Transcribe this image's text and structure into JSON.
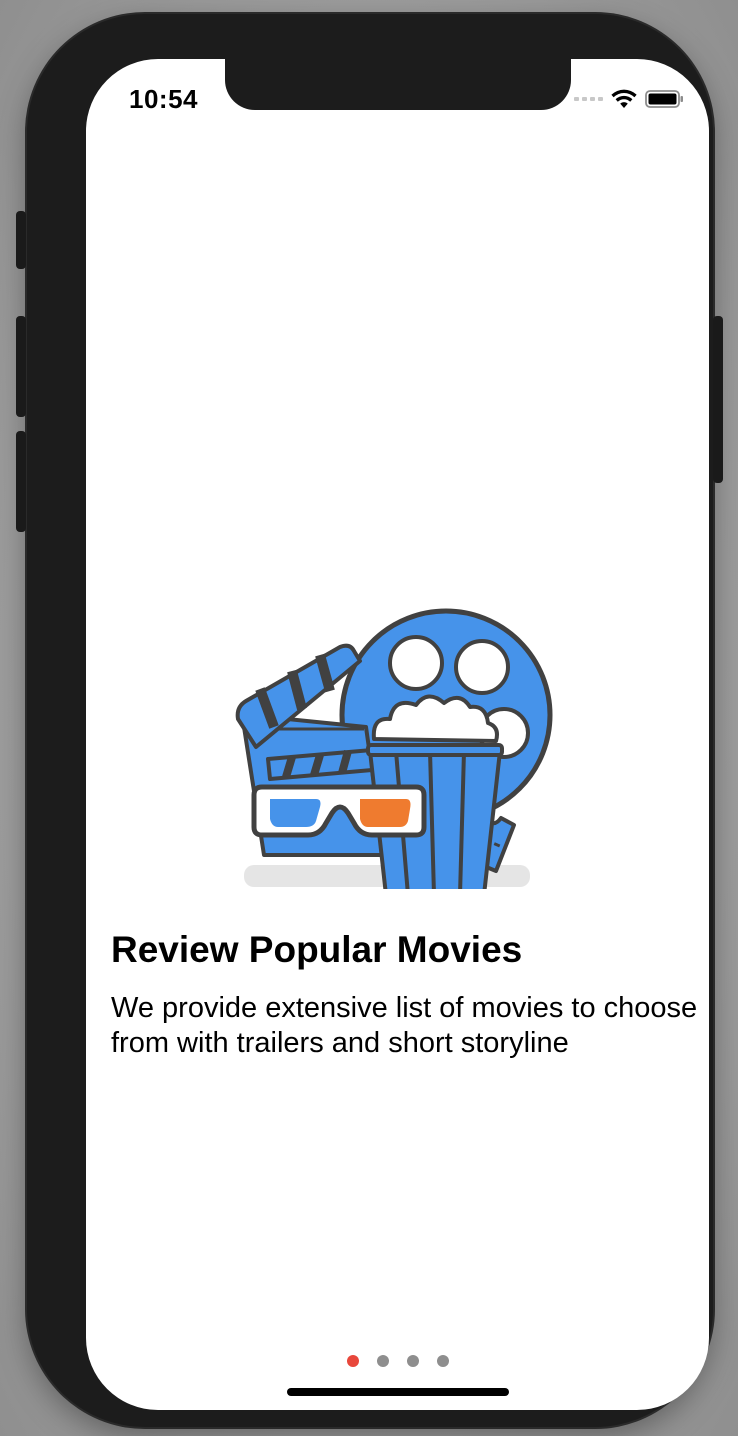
{
  "status_bar": {
    "time": "10:54"
  },
  "onboarding": {
    "illustration": "movie-reel-popcorn-3d-glasses-illustration",
    "title": "Review Popular Movies",
    "description": "We provide extensive list of movies to choose from with trailers and short storyline",
    "pagination": {
      "total": 4,
      "current_index": 0
    }
  },
  "colors": {
    "accent_blue": "#4693ea",
    "accent_orange": "#ef7b2f",
    "outline": "#414141",
    "active_dot": "#e8473b",
    "inactive_dot": "#8e8e8e"
  }
}
